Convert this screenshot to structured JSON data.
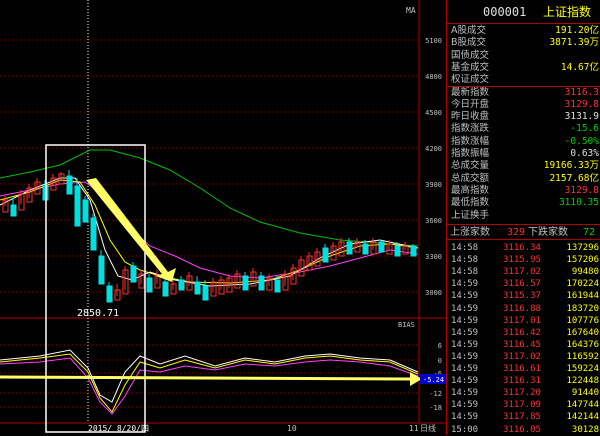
{
  "main_panel": {
    "top_indicator_label": "MA",
    "price_axis_labels": [
      "5100",
      "4800",
      "4500",
      "4200",
      "3900",
      "3600",
      "3300",
      "3000"
    ],
    "low_point_label": "2850.71",
    "sub_indicator_label": "BIAS",
    "bias_axis_labels": [
      "6",
      "0",
      "-6",
      "-12",
      "-18"
    ],
    "bias_current_value": "-5.24",
    "date_axis_label": "2015/ 8/20/四",
    "month_tick_10": "10",
    "month_tick_11": "11",
    "date_axis_right": "日线",
    "colors": {
      "up": "#ff3030",
      "down": "#00e0e0",
      "ma_white": "#ffffff",
      "ma_yellow": "#ffff00",
      "ma_magenta": "#ff40ff",
      "ma_green": "#00c000",
      "highlight_box": "#ffffff",
      "arrow": "#ffff66",
      "grid": "#8a0000"
    }
  },
  "right_panel": {
    "code": "000001",
    "name": "上证指数",
    "quotes": [
      {
        "label": "A股成交",
        "value": "191.20亿",
        "color": "#ffff00"
      },
      {
        "label": "B股成交",
        "value": "3871.39万",
        "color": "#ffff00"
      },
      {
        "label": "国债成交",
        "value": "",
        "color": "#ffff00"
      },
      {
        "label": "基金成交",
        "value": "14.67亿",
        "color": "#ffff00"
      },
      {
        "label": "权证成交",
        "value": "",
        "color": "#ffff00"
      },
      {
        "label": "最新指数",
        "value": "3116.3",
        "color": "#ff3030"
      },
      {
        "label": "今日开盘",
        "value": "3129.8",
        "color": "#ff3030"
      },
      {
        "label": "昨日收盘",
        "value": "3131.9",
        "color": "#e0e0e0"
      },
      {
        "label": "指数涨跌",
        "value": "-15.6",
        "color": "#00d000"
      },
      {
        "label": "指数涨幅",
        "value": "-0.50%",
        "color": "#00d000"
      },
      {
        "label": "指数振幅",
        "value": "0.63%",
        "color": "#e0e0e0"
      },
      {
        "label": "总成交量",
        "value": "19166.33万",
        "color": "#ffff00"
      },
      {
        "label": "总成交额",
        "value": "2157.68亿",
        "color": "#ffff00"
      },
      {
        "label": "最高指数",
        "value": "3129.8",
        "color": "#ff3030"
      },
      {
        "label": "最低指数",
        "value": "3110.35",
        "color": "#00d000"
      },
      {
        "label": "上证换手",
        "value": "",
        "color": "#e0e0e0"
      }
    ],
    "up_label": "上涨家数",
    "up_count": "329",
    "down_label": "下跌家数",
    "down_count": "72",
    "ticks": [
      {
        "time": "14:58",
        "price": "3116.34",
        "vol": "137296"
      },
      {
        "time": "14:58",
        "price": "3115.95",
        "vol": "157206"
      },
      {
        "time": "14:58",
        "price": "3117.02",
        "vol": "99480"
      },
      {
        "time": "14:59",
        "price": "3116.57",
        "vol": "170224"
      },
      {
        "time": "14:59",
        "price": "3115.37",
        "vol": "161944"
      },
      {
        "time": "14:59",
        "price": "3116.88",
        "vol": "183720"
      },
      {
        "time": "14:59",
        "price": "3117.01",
        "vol": "107776"
      },
      {
        "time": "14:59",
        "price": "3116.42",
        "vol": "167640"
      },
      {
        "time": "14:59",
        "price": "3116.45",
        "vol": "164376"
      },
      {
        "time": "14:59",
        "price": "3117.02",
        "vol": "116592"
      },
      {
        "time": "14:59",
        "price": "3116.61",
        "vol": "159224"
      },
      {
        "time": "14:59",
        "price": "3116.31",
        "vol": "122448"
      },
      {
        "time": "14:59",
        "price": "3117.20",
        "vol": "91440"
      },
      {
        "time": "14:59",
        "price": "3117.09",
        "vol": "147744"
      },
      {
        "time": "14:59",
        "price": "3117.85",
        "vol": "142144"
      },
      {
        "time": "15:00",
        "price": "3116.05",
        "vol": "30128"
      }
    ]
  }
}
